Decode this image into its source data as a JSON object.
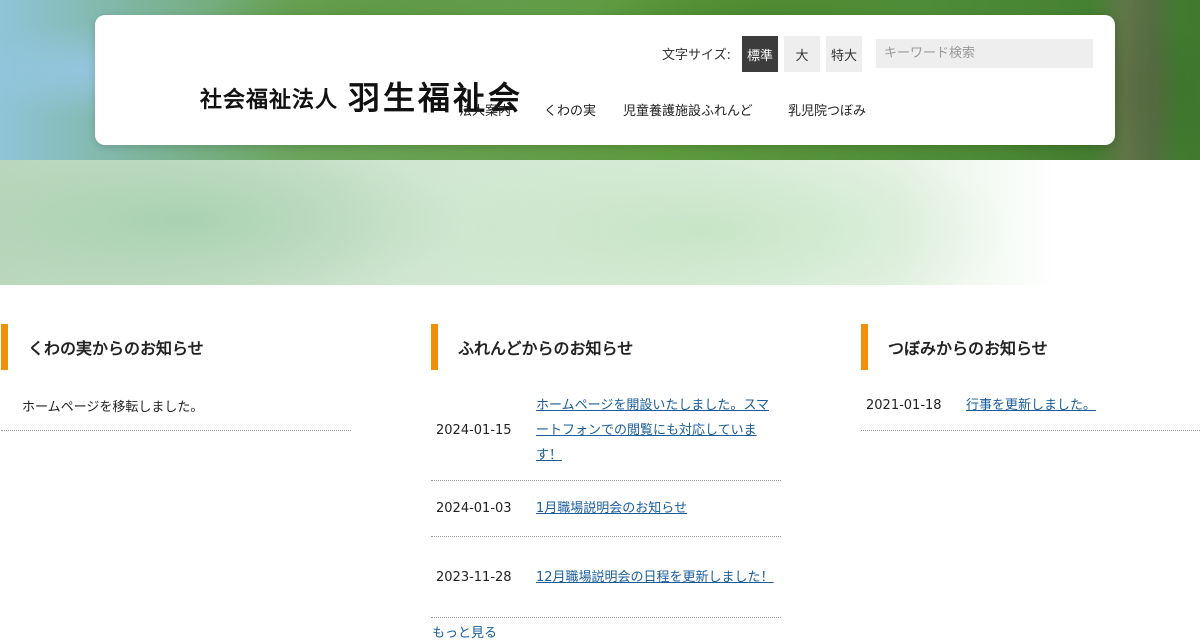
{
  "header": {
    "logo_small": "社会福祉法人",
    "logo_big": "羽生福祉会",
    "fontsize_label": "文字サイズ:",
    "fontsize_options": [
      "標準",
      "大",
      "特大"
    ],
    "search_placeholder": "キーワード検索",
    "nav": [
      "法人案内",
      "くわの実",
      "児童養護施設ふれんど",
      "乳児院つぼみ"
    ]
  },
  "columns": {
    "kuwanomi": {
      "title": "くわの実からのお知らせ",
      "items": [
        {
          "text": "ホームページを移転しました。"
        }
      ]
    },
    "friend": {
      "title": "ふれんどからのお知らせ",
      "items": [
        {
          "date": "2024-01-15",
          "text": "ホームページを開設いたしました。スマートフォンでの閲覧にも対応しています！"
        },
        {
          "date": "2024-01-03",
          "text": "1月職場説明会のお知らせ"
        },
        {
          "date": "2023-11-28",
          "text": "12月職場説明会の日程を更新しました！"
        }
      ],
      "more": "もっと見る"
    },
    "tsubomi": {
      "title": "つぼみからのお知らせ",
      "items": [
        {
          "date": "2021-01-18",
          "text": "行事を更新しました。"
        }
      ]
    }
  }
}
